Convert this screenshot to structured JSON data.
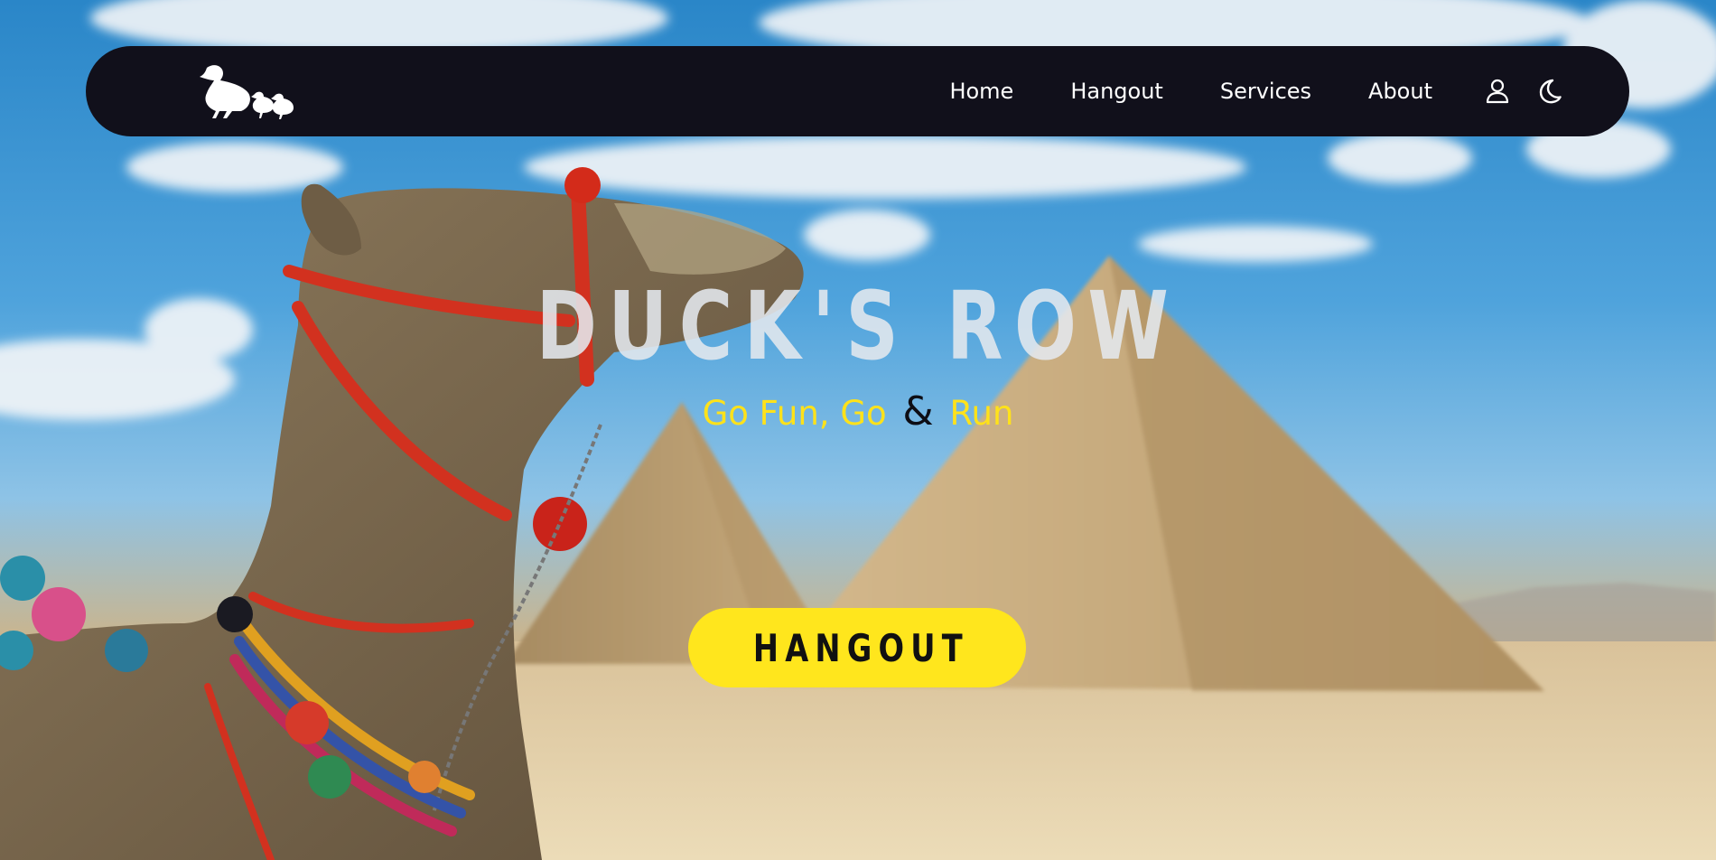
{
  "nav": {
    "logo_alt": "duck family logo",
    "links": [
      {
        "label": "Home"
      },
      {
        "label": "Hangout"
      },
      {
        "label": "Services"
      },
      {
        "label": "About"
      }
    ],
    "icons": [
      "user-icon",
      "moon-icon"
    ]
  },
  "hero": {
    "title": "DUCK'S ROW",
    "tagline_part1": "Go Fun, Go",
    "tagline_amp": "&",
    "tagline_part2": "Run",
    "cta_label": "HANGOUT"
  },
  "colors": {
    "navbar_bg": "#11101b",
    "accent_yellow": "#ffe61d",
    "title_color": "#e4e8ee"
  }
}
